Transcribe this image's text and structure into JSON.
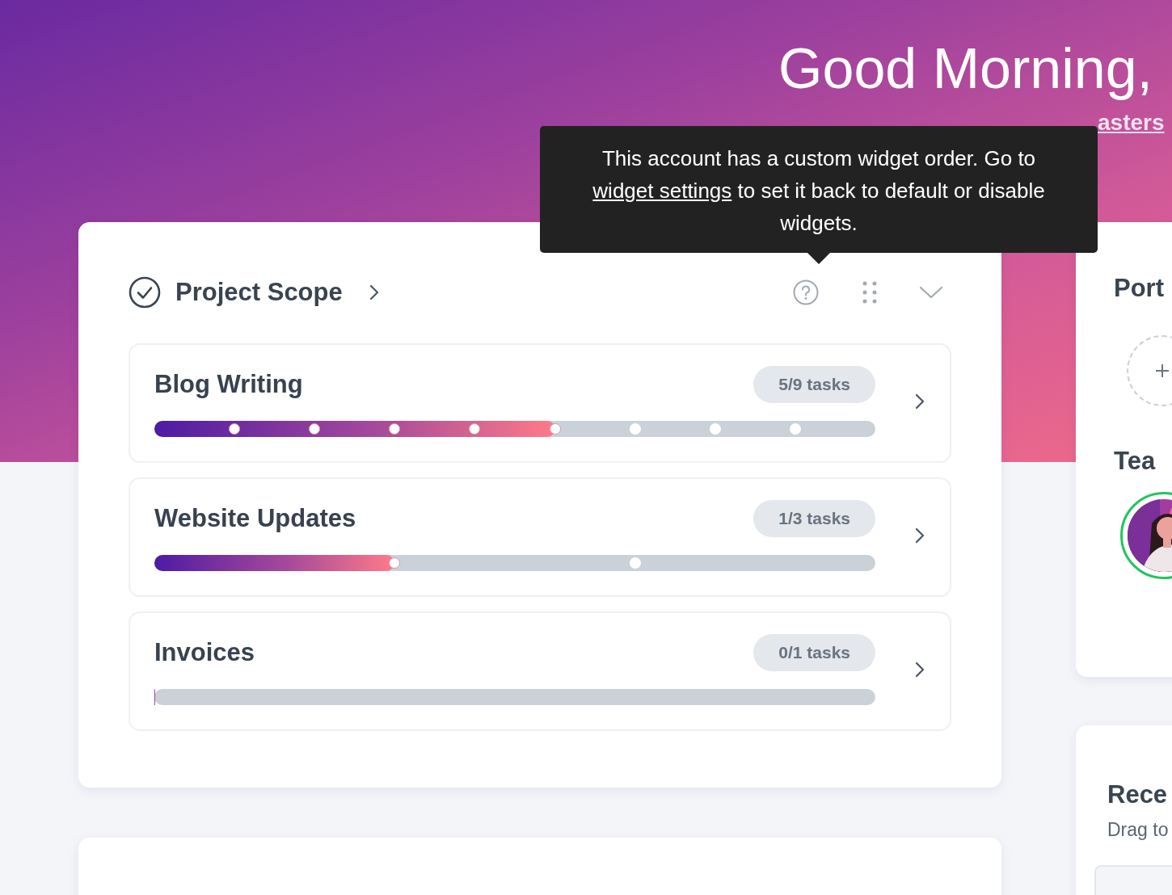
{
  "header": {
    "greeting": "Good Morning,",
    "company_link": "asters"
  },
  "tooltip": {
    "before": "This account has a custom widget order. Go to",
    "link": "widget settings",
    "after": "to set it back to default or disable widgets."
  },
  "project_scope": {
    "title": "Project Scope",
    "items": [
      {
        "name": "Blog Writing",
        "tasks": "5/9 tasks",
        "level": 0.556,
        "milestones": [
          {
            "done": true
          },
          {
            "done": true
          },
          {
            "done": true
          },
          {
            "done": true
          },
          {
            "done": true
          },
          {
            "done": false
          },
          {
            "done": false
          },
          {
            "done": false
          }
        ]
      },
      {
        "name": "Website Updates",
        "tasks": "1/3 tasks",
        "level": 0.333,
        "milestones": [
          {
            "done": true
          },
          {
            "done": false
          }
        ]
      },
      {
        "name": "Invoices",
        "tasks": "0/1 tasks",
        "level": 0
      }
    ]
  },
  "side": {
    "portal_title": "Port",
    "team_title": "Tea",
    "recent_title": "Rece",
    "recent_hint": "Drag to"
  }
}
